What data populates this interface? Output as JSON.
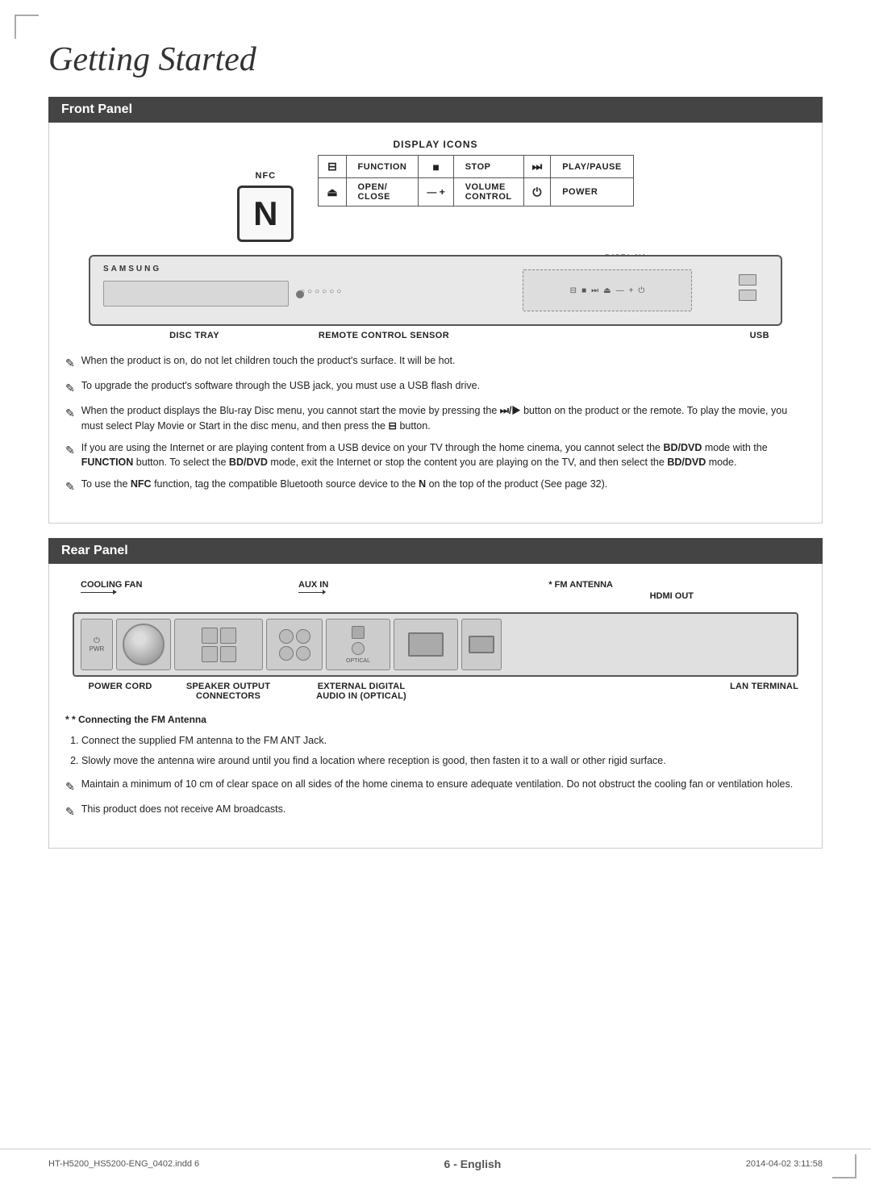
{
  "page": {
    "title": "Getting Started",
    "footer": {
      "left": "HT-H5200_HS5200-ENG_0402.indd   6",
      "right": "2014-04-02   3:11:58",
      "page_number": "6",
      "page_suffix": " - English"
    }
  },
  "front_panel": {
    "section_title": "Front Panel",
    "display_icons_label": "DISPLAY ICONS",
    "nfc_label": "NFC",
    "icons": [
      {
        "symbol": "⊟",
        "label": "FUNCTION"
      },
      {
        "symbol": "■",
        "label": "STOP"
      },
      {
        "symbol": "⏭",
        "label": "PLAY/PAUSE"
      },
      {
        "symbol": "⏏",
        "label": "OPEN/\nCLOSE"
      },
      {
        "symbol": "— +",
        "label": "VOLUME\nCONTROL"
      },
      {
        "symbol": "⏻",
        "label": "POWER"
      }
    ],
    "device_labels": {
      "samsung": "SAMSUNG",
      "disc_tray": "DISC TRAY",
      "remote_sensor": "REMOTE CONTROL SENSOR",
      "display": "DISPLAY",
      "usb": "USB"
    },
    "notes": [
      "When the product is on, do not let children touch the product's surface. It will be hot.",
      "To upgrade the product's software through the USB jack, you must use a USB flash drive.",
      "When the product displays the Blu-ray Disc menu, you cannot start the movie by pressing the ⏭/▶ button on the product or the remote. To play the movie, you must select Play Movie or Start in the disc menu, and then press the ⊟ button.",
      "If you are using the Internet or are playing content from a USB device on your TV through the home cinema, you cannot select the BD/DVD mode with the FUNCTION button. To select the BD/DVD mode, exit the Internet or stop the content you are playing on the TV, and then select the BD/DVD mode.",
      "To use the NFC function, tag the compatible Bluetooth source device to the N on the top of the product (See page 32)."
    ]
  },
  "rear_panel": {
    "section_title": "Rear Panel",
    "labels": {
      "cooling_fan": "COOLING FAN",
      "aux_in": "AUX IN",
      "fm_antenna": "* FM ANTENNA",
      "hdmi_out": "HDMI OUT",
      "power_cord": "POWER CORD",
      "speaker_output": "SPEAKER OUTPUT\nCONNECTORS",
      "external_digital": "EXTERNAL DIGITAL\nAUDIO IN (OPTICAL)",
      "lan_terminal": "LAN TERMINAL"
    },
    "fm_section": {
      "title": "* Connecting the FM Antenna",
      "steps": [
        "Connect the supplied FM antenna to the FM ANT Jack.",
        "Slowly move the antenna wire around until you find a location where reception is good, then fasten it to a wall or other rigid surface."
      ],
      "notes": [
        "Maintain a minimum of 10 cm of clear space on all sides of the home cinema to ensure adequate ventilation. Do not obstruct the cooling fan or ventilation holes.",
        "This product does not receive AM broadcasts."
      ]
    }
  }
}
